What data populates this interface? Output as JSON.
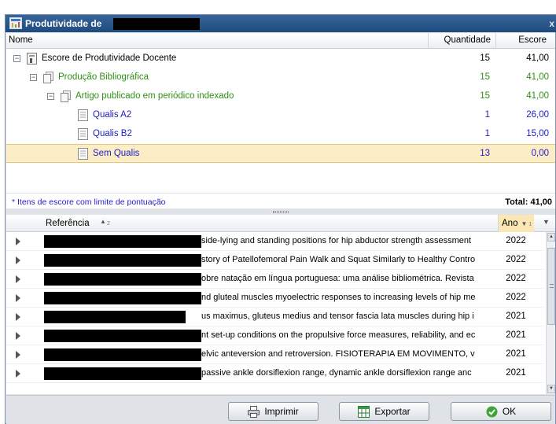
{
  "window": {
    "title": "Produtividade de",
    "close_label": "x"
  },
  "tree": {
    "columns": {
      "name": "Nome",
      "quantity": "Quantidade",
      "score": "Escore"
    },
    "rows": [
      {
        "label": "Escore de Produtividade Docente",
        "quantity": "15",
        "score": "41,00"
      },
      {
        "label": "Produção Bibliográfica",
        "quantity": "15",
        "score": "41,00"
      },
      {
        "label": "Artigo publicado em periódico indexado",
        "quantity": "15",
        "score": "41,00"
      },
      {
        "label": "Qualis A2",
        "quantity": "1",
        "score": "26,00"
      },
      {
        "label": "Qualis B2",
        "quantity": "1",
        "score": "15,00"
      },
      {
        "label": "Sem Qualis",
        "quantity": "13",
        "score": "0,00"
      }
    ],
    "footnote": "* Itens de escore com limite de pontuação",
    "total": "Total: 41,00"
  },
  "grid": {
    "columns": {
      "reference": "Referência",
      "reference_sort_index": "2",
      "year": "Ano",
      "year_sort_index": "1"
    },
    "rows": [
      {
        "reference": "side-lying and standing positions for hip abductor strength assessment",
        "year": "2022"
      },
      {
        "reference": "story of Patellofemoral Pain Walk and Squat Similarly to Healthy Contro",
        "year": "2022"
      },
      {
        "reference": "obre natação em língua portuguesa: uma análise bibliométrica. Revista",
        "year": "2022"
      },
      {
        "reference": "nd gluteal muscles myoelectric responses to increasing levels of hip me",
        "year": "2022"
      },
      {
        "reference": "us maximus, gluteus medius and tensor fascia lata muscles during hip i",
        "year": "2021"
      },
      {
        "reference": "nt set-up conditions on the propulsive force measures, reliability, and ec",
        "year": "2021"
      },
      {
        "reference": "elvic anteversion and retroversion. FISIOTERAPIA EM MOVIMENTO, v",
        "year": "2021"
      },
      {
        "reference": "passive ankle dorsiflexion range, dynamic ankle dorsiflexion range anc",
        "year": "2021"
      }
    ]
  },
  "buttons": {
    "print": "Imprimir",
    "export": "Exportar",
    "ok": "OK"
  },
  "icons": {
    "window": "app-window-icon",
    "expander": "minus-expander-icon",
    "root": "score-document-icon",
    "folder": "stack-folder-icon",
    "leaf": "text-document-icon",
    "row": "row-expand-arrow-icon",
    "print": "printer-icon",
    "export": "excel-export-icon",
    "ok": "green-check-icon"
  },
  "colors": {
    "titlebar": "#2a5689",
    "green_level": "#2f8f17",
    "blue_level": "#1d1dc6",
    "selected_row": "#fbedc5"
  }
}
